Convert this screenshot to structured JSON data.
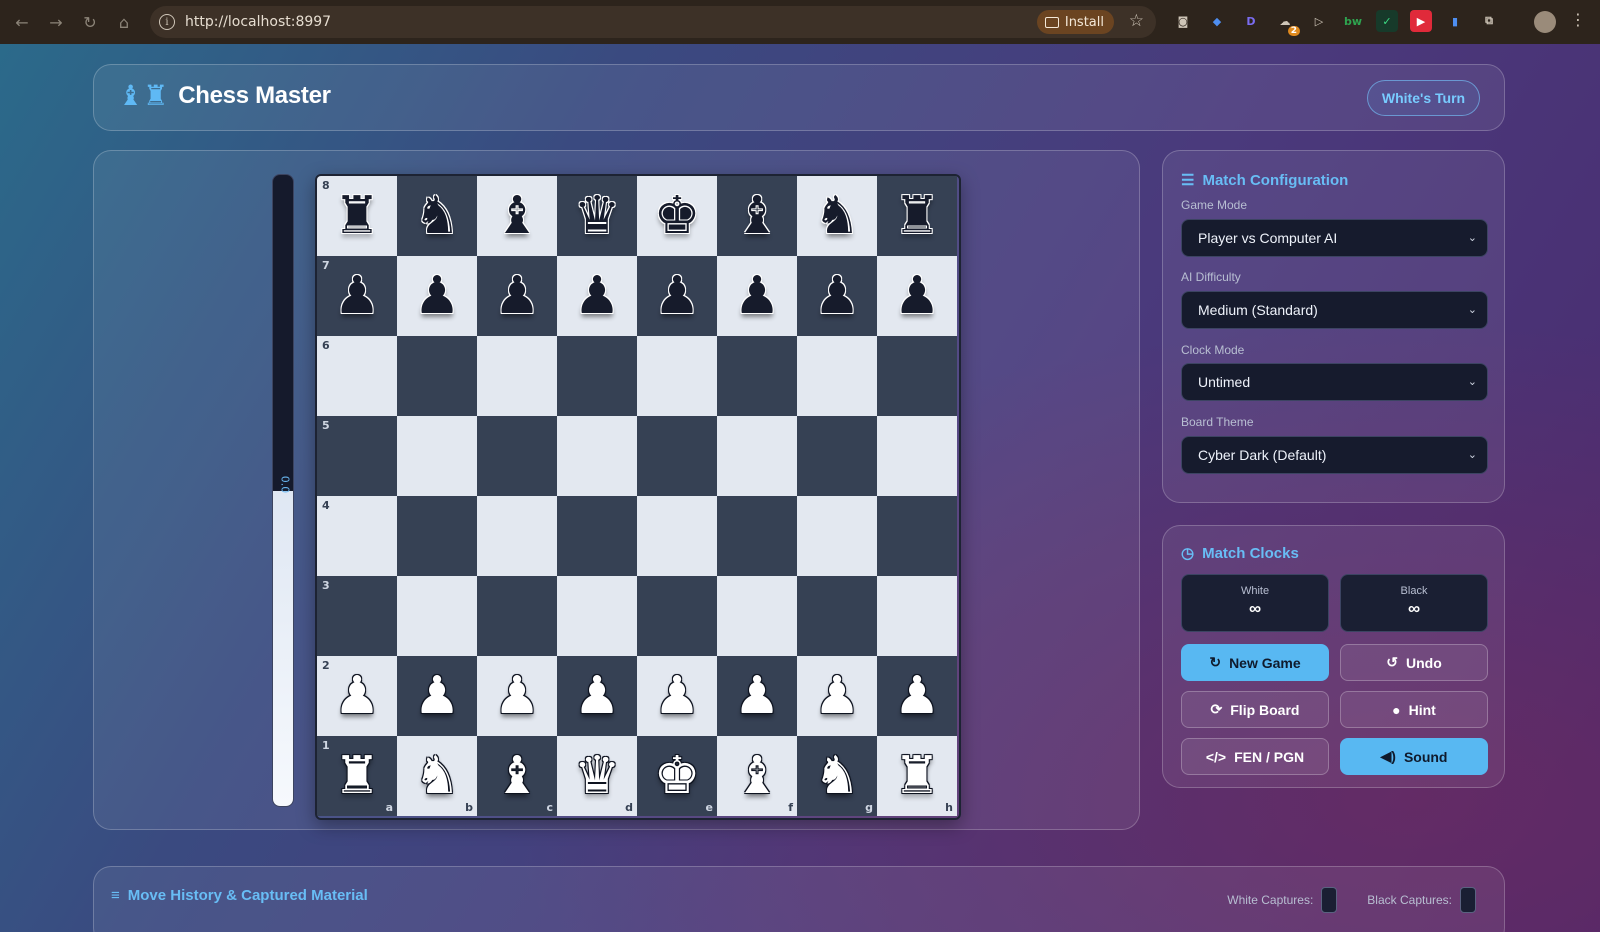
{
  "browser": {
    "url": "http://localhost:8997",
    "install_label": "Install",
    "extension_badge": "2"
  },
  "header": {
    "title": "Chess Master",
    "turn_label": "White's Turn"
  },
  "eval": {
    "value": "0.0",
    "white_fraction": 0.5
  },
  "board": {
    "ranks": [
      "8",
      "7",
      "6",
      "5",
      "4",
      "3",
      "2",
      "1"
    ],
    "files": [
      "a",
      "b",
      "c",
      "d",
      "e",
      "f",
      "g",
      "h"
    ],
    "rows": [
      [
        "bR",
        "bN",
        "bB",
        "bQ",
        "bK",
        "bB",
        "bN",
        "bR"
      ],
      [
        "bP",
        "bP",
        "bP",
        "bP",
        "bP",
        "bP",
        "bP",
        "bP"
      ],
      [
        "",
        "",
        "",
        "",
        "",
        "",
        "",
        ""
      ],
      [
        "",
        "",
        "",
        "",
        "",
        "",
        "",
        ""
      ],
      [
        "",
        "",
        "",
        "",
        "",
        "",
        "",
        ""
      ],
      [
        "",
        "",
        "",
        "",
        "",
        "",
        "",
        ""
      ],
      [
        "wP",
        "wP",
        "wP",
        "wP",
        "wP",
        "wP",
        "wP",
        "wP"
      ],
      [
        "wR",
        "wN",
        "wB",
        "wQ",
        "wK",
        "wB",
        "wN",
        "wR"
      ]
    ]
  },
  "config": {
    "title": "Match Configuration",
    "game_mode_label": "Game Mode",
    "game_mode_value": "Player vs Computer AI",
    "difficulty_label": "AI Difficulty",
    "difficulty_value": "Medium (Standard)",
    "clock_label": "Clock Mode",
    "clock_value": "Untimed",
    "theme_label": "Board Theme",
    "theme_value": "Cyber Dark (Default)"
  },
  "clocks": {
    "title": "Match Clocks",
    "white_label": "White",
    "white_value": "∞",
    "black_label": "Black",
    "black_value": "∞"
  },
  "actions": {
    "new_game": "New Game",
    "undo": "Undo",
    "flip_board": "Flip Board",
    "hint": "Hint",
    "fen_pgn": "FEN / PGN",
    "sound": "Sound"
  },
  "history": {
    "title": "Move History & Captured Material",
    "white_captures_label": "White Captures:",
    "black_captures_label": "Black Captures:"
  },
  "colors": {
    "accent": "#58b8f2",
    "light_square": "#e3e8f0",
    "dark_square": "#364154"
  }
}
